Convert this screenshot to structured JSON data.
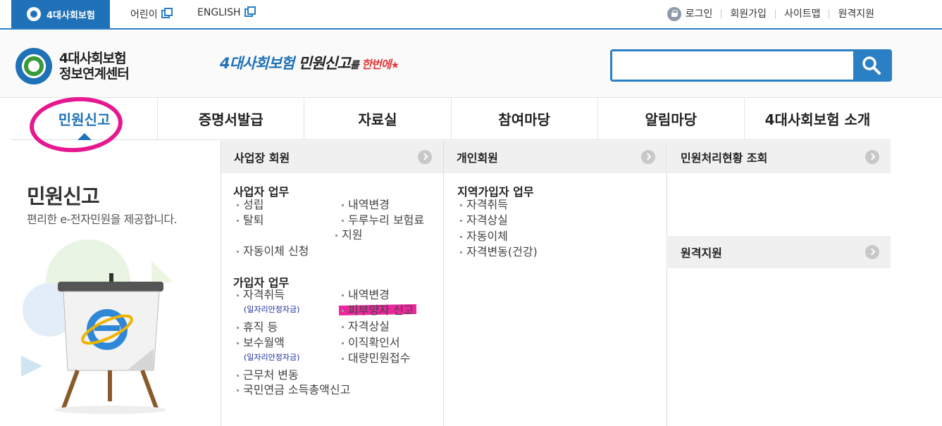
{
  "topbar": {
    "brand": "4대사회보험",
    "links": [
      "어린이",
      "ENGLISH"
    ],
    "utils": [
      "로그인",
      "회원가입",
      "사이트맵",
      "원격지원"
    ]
  },
  "header": {
    "logo_line1": "4대사회보험",
    "logo_line2": "정보연계센터",
    "slogan": {
      "part1": "4대사회보험",
      "part2": " 민원신고",
      "part3": "를",
      "part4": " 한번에"
    },
    "search": {
      "placeholder": "",
      "value": ""
    }
  },
  "gnb": {
    "items": [
      "민원신고",
      "증명서발급",
      "자료실",
      "참여마당",
      "알림마당",
      "4대사회보험 소개"
    ],
    "active_index": 0
  },
  "intro": {
    "title": "민원신고",
    "subtitle": "편리한 e-전자민원을 제공합니다."
  },
  "menu": {
    "col1": {
      "heading": "사업장 회원",
      "biz_title": "사업자 업무",
      "biz_left": [
        "성립",
        "탈퇴",
        "자동이체 신청"
      ],
      "biz_right": [
        "내역변경",
        "두루누리 보험료",
        "지원"
      ],
      "sub_title": "가입자 업무",
      "sub_left": [
        "자격취득",
        "휴직 등",
        "보수월액",
        "근무처 변동",
        "국민연금 소득총액신고"
      ],
      "sub_left_notes": [
        "(일자리안정자금)",
        "(일자리안정자금)"
      ],
      "sub_right": [
        "내역변경",
        "피부양자 신고",
        "자격상실",
        "이직확인서",
        "대량민원접수"
      ]
    },
    "col2": {
      "heading": "개인회원",
      "title": "지역가입자 업무",
      "items": [
        "자격취득",
        "자격상실",
        "자동이체",
        "자격변동(건강)"
      ]
    },
    "col3": {
      "heading1": "민원처리현황 조회",
      "heading2": "원격지원"
    }
  },
  "colors": {
    "brand_blue": "#1f72b8",
    "highlight_pink": "#e6188f"
  }
}
